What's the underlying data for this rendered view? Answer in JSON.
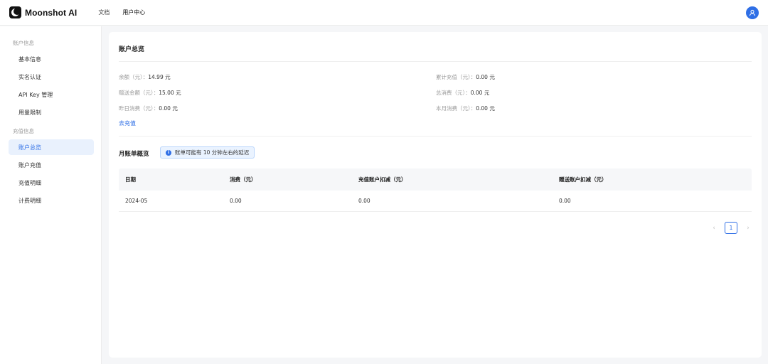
{
  "header": {
    "brand": "Moonshot AI",
    "nav": [
      {
        "label": "文档",
        "active": false
      },
      {
        "label": "用户中心",
        "active": true
      }
    ],
    "accent_color": "#2f6fe6"
  },
  "sidebar": {
    "groups": [
      {
        "title": "账户信息",
        "items": [
          {
            "label": "基本信息"
          },
          {
            "label": "实名认证"
          },
          {
            "label": "API Key 管理"
          },
          {
            "label": "用量限制"
          }
        ]
      },
      {
        "title": "充值信息",
        "items": [
          {
            "label": "账户总览",
            "active": true
          },
          {
            "label": "账户充值"
          },
          {
            "label": "充值明细"
          },
          {
            "label": "计费明细"
          }
        ]
      }
    ]
  },
  "overview": {
    "title": "账户总览",
    "fields": {
      "balance": {
        "label": "余额（元）",
        "sep": "：",
        "value": "14.99 元"
      },
      "total_recharge": {
        "label": "累计充值（元）",
        "sep": "：",
        "value": "0.00 元"
      },
      "gift": {
        "label": "赠送金额（元）",
        "sep": "：",
        "value": "15.00 元"
      },
      "total_consume": {
        "label": "总消费（元）",
        "sep": "：",
        "value": "0.00 元"
      },
      "yesterday": {
        "label": "昨日消费（元）",
        "sep": "：",
        "value": "0.00 元"
      },
      "month": {
        "label": "本月消费（元）",
        "sep": "：",
        "value": "0.00 元"
      }
    },
    "recharge_link": "去充值"
  },
  "monthly": {
    "title": "月账单概览",
    "notice": "账单可能有 10 分钟左右的延迟",
    "notice_icon": "info-icon",
    "columns": [
      "日期",
      "消费（元）",
      "充值账户扣减（元）",
      "赠送账户扣减（元）"
    ],
    "rows": [
      [
        "2024-05",
        "0.00",
        "0.00",
        "0.00"
      ]
    ],
    "pagination": {
      "prev": "‹",
      "page": "1",
      "next": "›"
    }
  }
}
